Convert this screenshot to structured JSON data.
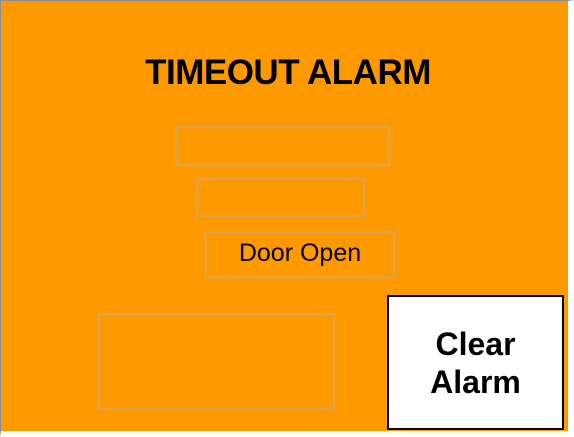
{
  "title": "TIMEOUT ALARM",
  "fields": {
    "field_1_value": "",
    "field_2_value": "",
    "status_text": "Door Open",
    "field_4_value": ""
  },
  "button": {
    "line_1": "Clear",
    "line_2": "Alarm"
  },
  "colors": {
    "background": "#ff9900",
    "field_border": "#d9a35a",
    "button_background": "#ffffff",
    "text": "#000000"
  }
}
